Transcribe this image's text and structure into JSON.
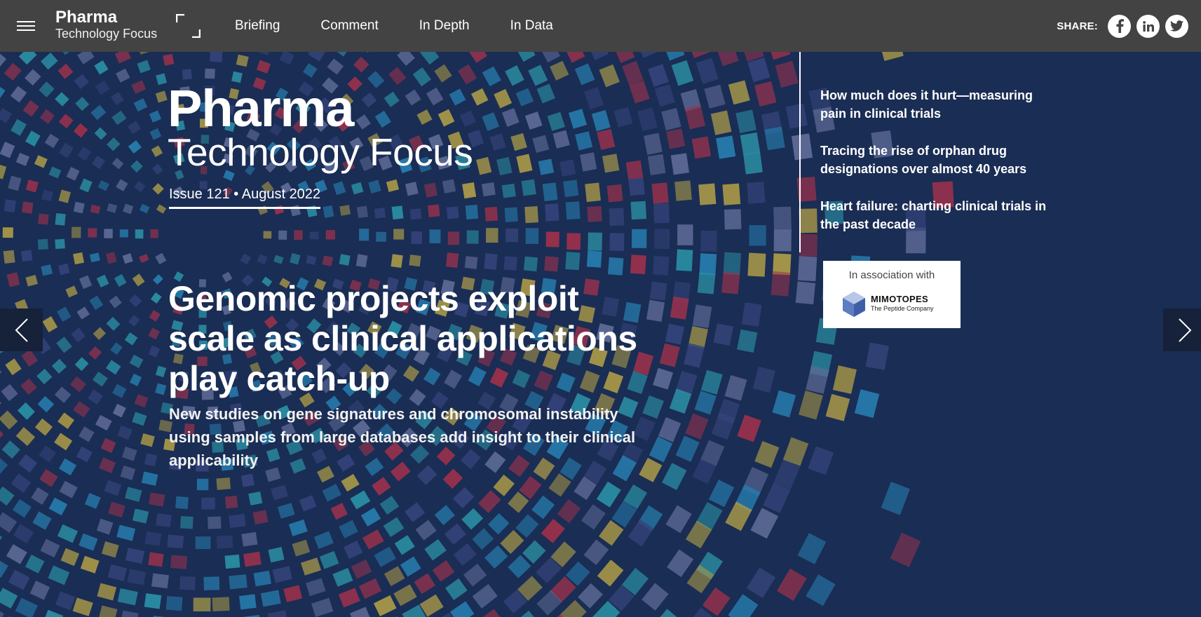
{
  "header": {
    "menu_icon": "hamburger-icon",
    "logo_line1": "Pharma",
    "logo_line2": "Technology Focus",
    "expand_icon": "fullscreen-icon",
    "nav": [
      {
        "label": "Briefing"
      },
      {
        "label": "Comment"
      },
      {
        "label": "In Depth"
      },
      {
        "label": "In Data"
      }
    ],
    "share_label": "SHARE:",
    "share_icons": [
      "facebook-icon",
      "linkedin-icon",
      "twitter-icon"
    ]
  },
  "hero": {
    "logo_line1": "Pharma",
    "logo_line2": "Technology Focus",
    "issue": "Issue 121 • August 2022",
    "headline": "Genomic projects exploit scale as clinical applications play catch-up",
    "subhead": "New studies on gene signatures and chromosomal instability using samples from large databases add insight to their clinical applicability",
    "side_articles": [
      {
        "title": "How much does it hurt—measuring pain in clinical trials"
      },
      {
        "title": "Tracing the rise of orphan drug designations over almost 40 years"
      },
      {
        "title": "Heart failure: charting clinical trials in the past decade"
      }
    ],
    "association_label": "In association with",
    "sponsor_name": "MIMOTOPES",
    "sponsor_tagline": "The Peptide Company",
    "prev_icon": "chevron-left-icon",
    "next_icon": "chevron-right-icon"
  },
  "colors": {
    "topbar": "#434343",
    "hero_background": "#1c2f57",
    "text": "#ffffff",
    "art_palette": [
      "#2a8fc4",
      "#c9b248",
      "#b8344e",
      "#3c4a86",
      "#6e7aa8",
      "#2fa6b8"
    ]
  }
}
